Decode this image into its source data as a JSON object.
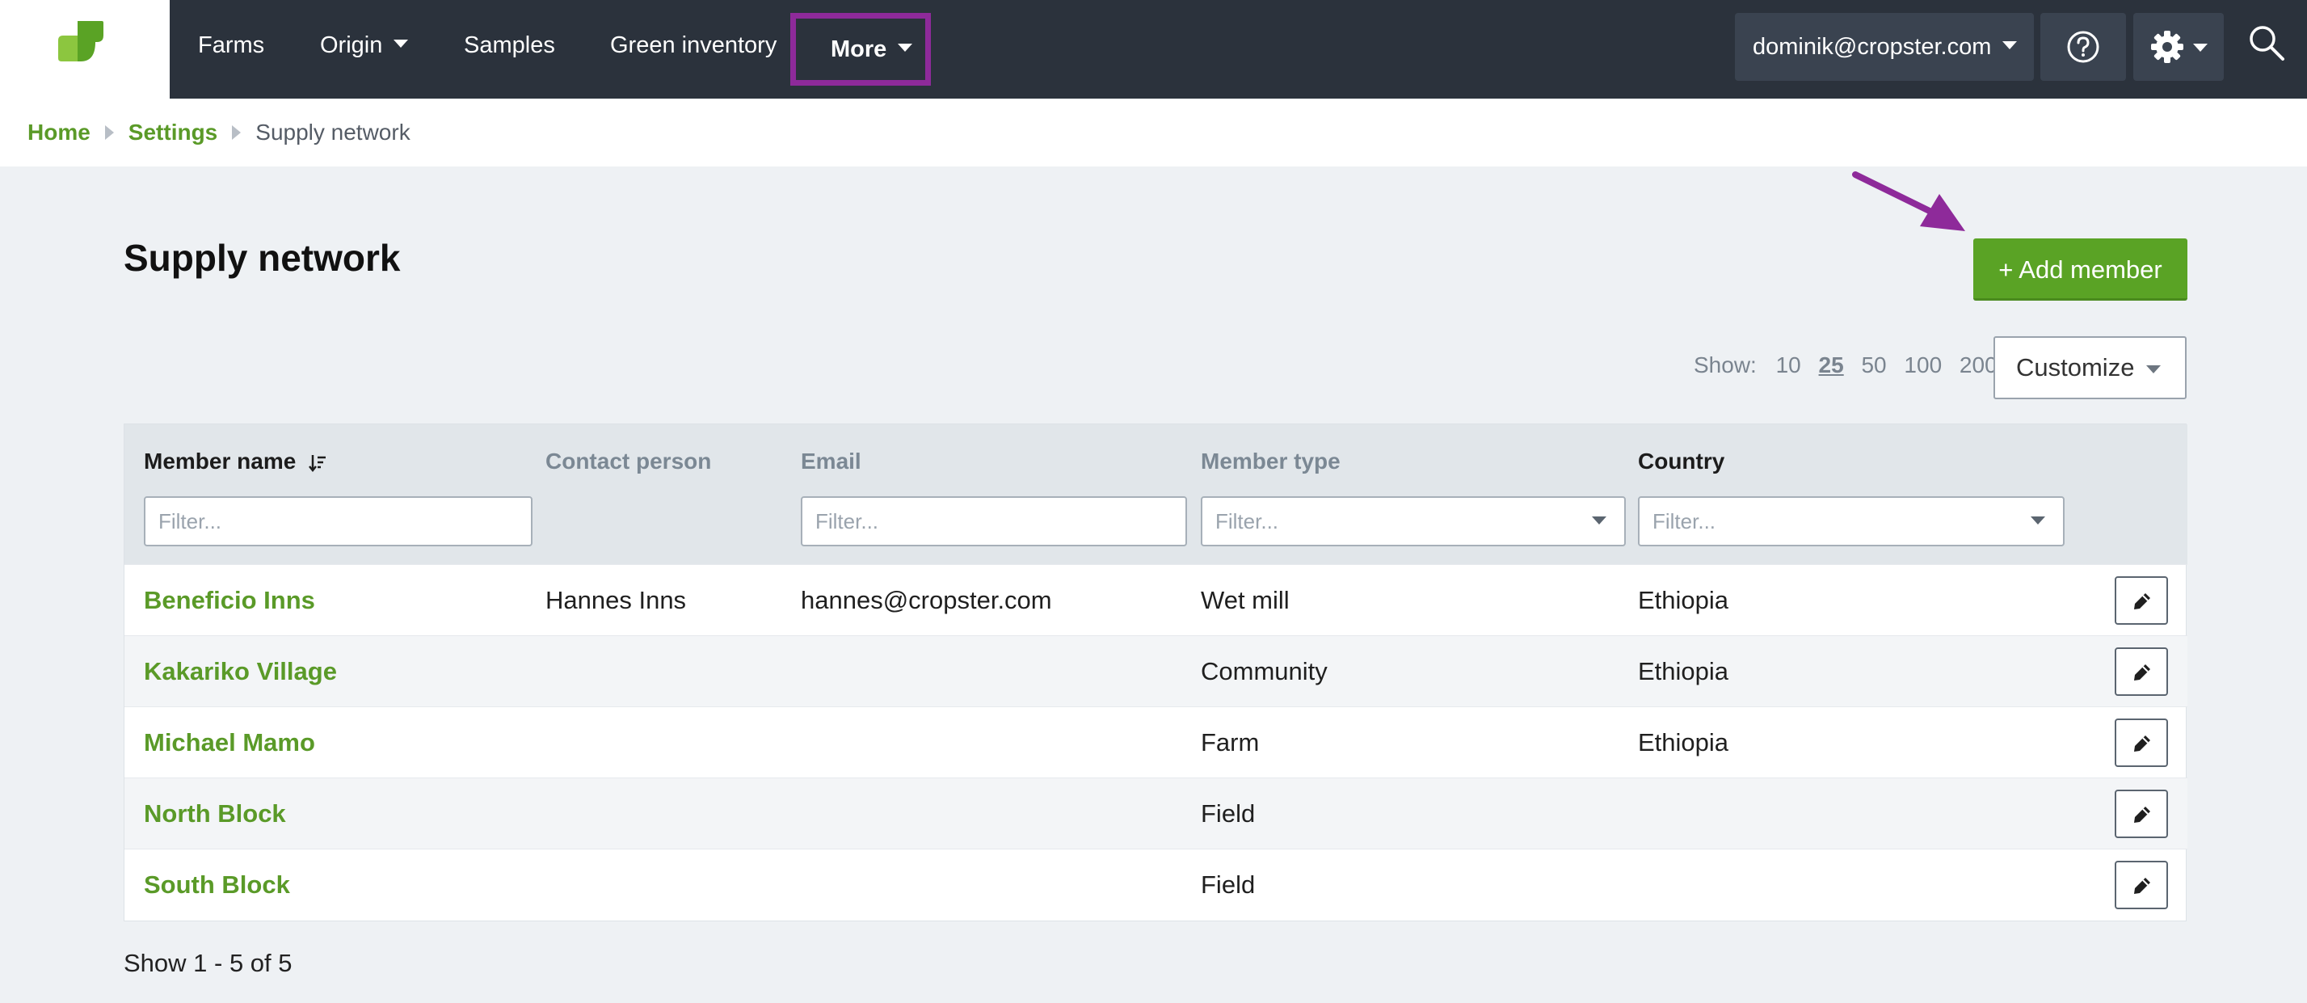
{
  "nav": {
    "items": [
      {
        "label": "Farms",
        "dropdown": false
      },
      {
        "label": "Origin",
        "dropdown": true
      },
      {
        "label": "Samples",
        "dropdown": false
      },
      {
        "label": "Green inventory",
        "dropdown": false
      },
      {
        "label": "More",
        "dropdown": true,
        "highlighted": true
      }
    ],
    "user_email": "dominik@cropster.com",
    "help_icon": "question-circle-icon",
    "settings_icon": "gear-icon",
    "search_icon": "search-icon",
    "brand_color": "#5aa325",
    "highlight_color": "#8e2a9a"
  },
  "breadcrumb": {
    "home": "Home",
    "settings": "Settings",
    "current": "Supply network"
  },
  "page": {
    "title": "Supply network",
    "add_member_label": "+ Add member",
    "show_label": "Show:",
    "page_sizes": [
      "10",
      "25",
      "50",
      "100",
      "200"
    ],
    "active_page_size": "25",
    "customize_label": "Customize"
  },
  "table": {
    "columns": {
      "member_name": "Member name",
      "contact_person": "Contact person",
      "email": "Email",
      "member_type": "Member type",
      "country": "Country"
    },
    "filters": {
      "member_name": "Filter...",
      "email": "Filter...",
      "member_type": "Filter...",
      "country": "Filter..."
    },
    "rows": [
      {
        "name": "Beneficio Inns",
        "contact": "Hannes Inns",
        "email": "hannes@cropster.com",
        "type": "Wet mill",
        "country": "Ethiopia"
      },
      {
        "name": "Kakariko Village",
        "contact": "",
        "email": "",
        "type": "Community",
        "country": "Ethiopia"
      },
      {
        "name": "Michael Mamo",
        "contact": "",
        "email": "",
        "type": "Farm",
        "country": "Ethiopia"
      },
      {
        "name": "North Block",
        "contact": "",
        "email": "",
        "type": "Field",
        "country": ""
      },
      {
        "name": "South Block",
        "contact": "",
        "email": "",
        "type": "Field",
        "country": ""
      }
    ]
  },
  "footer": {
    "count_text": "Show 1 - 5 of 5"
  }
}
